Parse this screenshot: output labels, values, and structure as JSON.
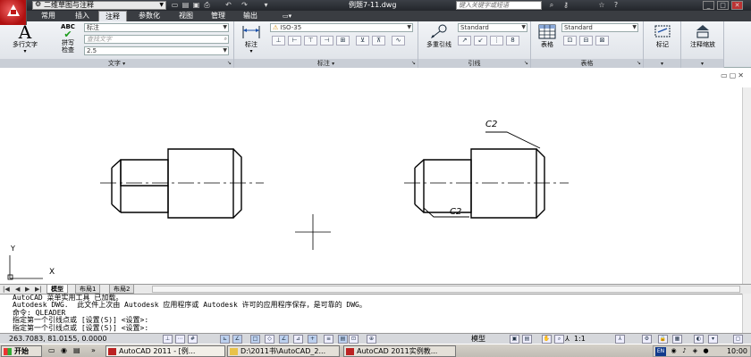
{
  "title_bar": {
    "workspace": "二维草图与注释",
    "document_title": "例题7-11.dwg",
    "search_placeholder": "键入关键字或短语",
    "icons": [
      "binoculars-icon",
      "key-icon",
      "star-icon",
      "help-icon"
    ]
  },
  "tabs": [
    {
      "label": "常用"
    },
    {
      "label": "插入"
    },
    {
      "label": "注释",
      "active": true
    },
    {
      "label": "参数化"
    },
    {
      "label": "视图"
    },
    {
      "label": "管理"
    },
    {
      "label": "输出"
    }
  ],
  "ribbon": {
    "text_panel": {
      "title": "文字",
      "mtext_label": "多行文字",
      "mtext_glyph": "A",
      "spell_label_1": "拼写",
      "spell_label_2": "检查",
      "spell_glyph": "ABC",
      "style_value": "标注",
      "find_placeholder": "查找文字",
      "height_value": "2.5"
    },
    "dim_panel": {
      "title": "标注",
      "dim_label": "标注",
      "style_value": "ISO-35"
    },
    "leader_panel": {
      "title": "引线",
      "multileader_label": "多重引线",
      "style_value": "Standard"
    },
    "table_panel": {
      "title": "表格",
      "table_label": "表格",
      "style_value": "Standard"
    },
    "markup_panel": {
      "label": "标记"
    },
    "scale_panel": {
      "label": "注释缩放"
    }
  },
  "drawing": {
    "left_chamfer_label": "C2",
    "right_chamfer_label": "C2",
    "ucs_x": "X",
    "ucs_y": "Y"
  },
  "layout_tabs": [
    {
      "label": "模型",
      "active": true
    },
    {
      "label": "布局1"
    },
    {
      "label": "布局2"
    }
  ],
  "command_lines": [
    "AutoCAD 菜单实用工具 已加载。",
    "Autodesk DWG.  此文件上次由 Autodesk 应用程序或 Autodesk 许可的应用程序保存，是可靠的 DWG。",
    "命令: QLEADER",
    "指定第一个引线点或 [设置(S)] <设置>:",
    "指定第一个引线点或 [设置(S)] <设置>:"
  ],
  "status_bar": {
    "coordinates": "263.7083, 81.0155, 0.0000",
    "model_label": "模型",
    "scale_label": "1:1"
  },
  "taskbar": {
    "start_label": "开始",
    "tasks": [
      {
        "label": "AutoCAD 2011 - [例...",
        "icon": "autocad-icon"
      },
      {
        "label": "D:\\2011书\\AutoCAD_2...",
        "icon": "folder-icon"
      },
      {
        "label": "AutoCAD 2011实例教...",
        "icon": "autocad-icon"
      }
    ],
    "lang": "EN",
    "clock": "10:00"
  }
}
